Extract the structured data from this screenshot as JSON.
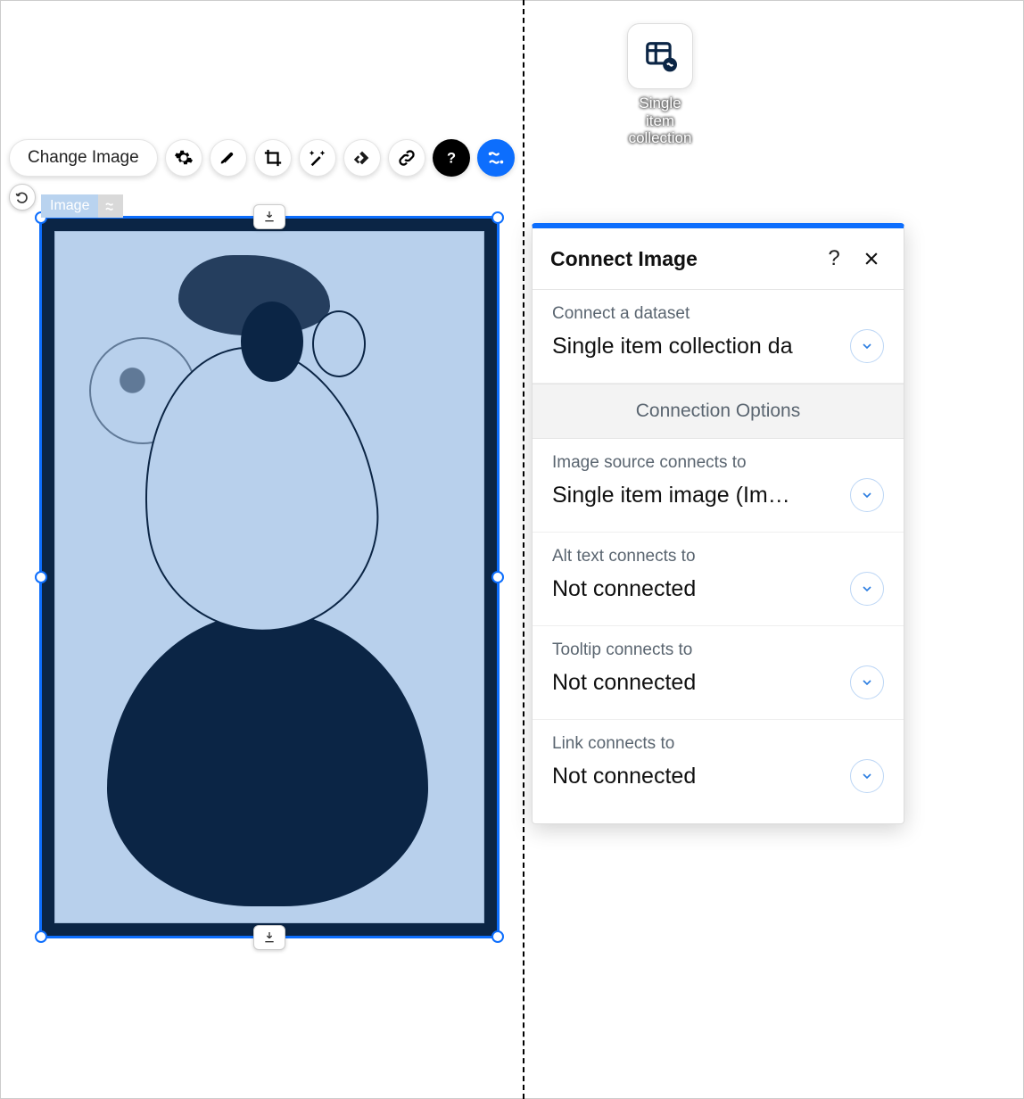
{
  "toolbar": {
    "change_image_label": "Change Image"
  },
  "element_tag": "Image",
  "dataset_chip": {
    "caption": "Single item collection"
  },
  "panel": {
    "title": "Connect Image",
    "dataset": {
      "label": "Connect a dataset",
      "value": "Single item collection da"
    },
    "options_header": "Connection Options",
    "image_source": {
      "label": "Image source connects to",
      "value": "Single item image (Im…"
    },
    "alt_text": {
      "label": "Alt text connects to",
      "value": "Not connected"
    },
    "tooltip": {
      "label": "Tooltip connects to",
      "value": "Not connected"
    },
    "link": {
      "label": "Link connects to",
      "value": "Not connected"
    }
  }
}
